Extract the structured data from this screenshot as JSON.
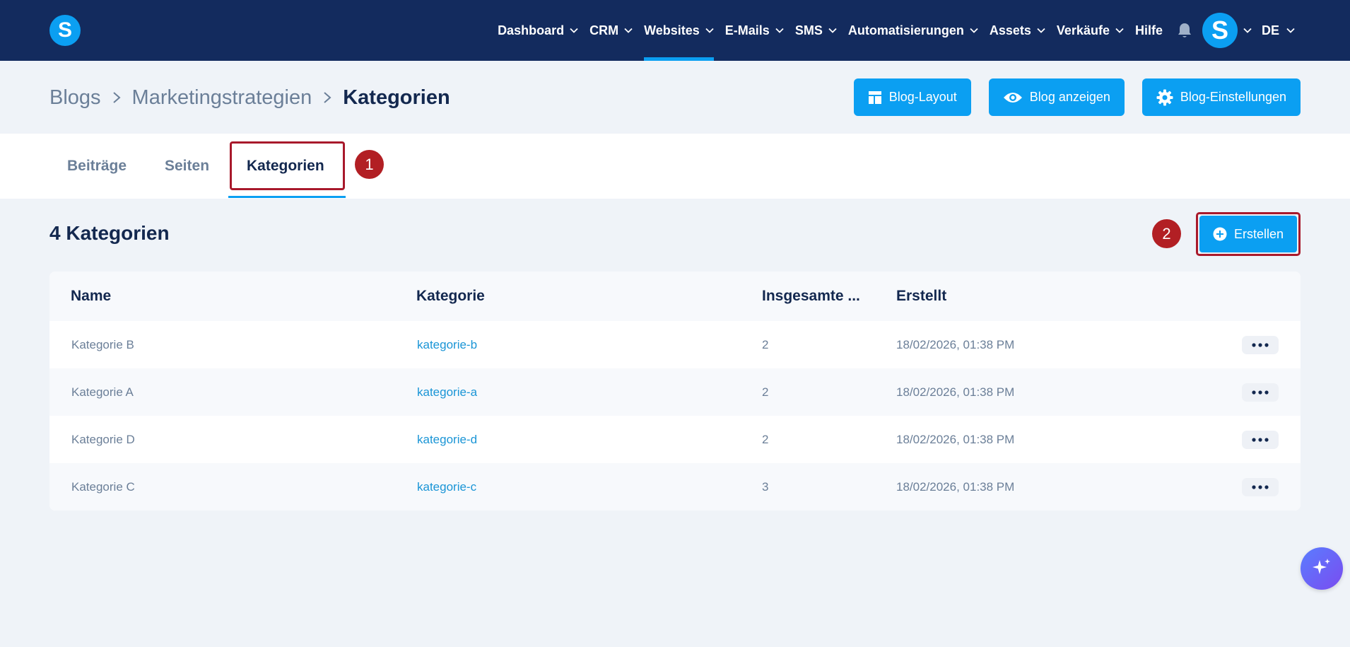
{
  "brand": {
    "logo_letter": "S",
    "accent": "#0b9ff2",
    "nav_bg": "#132b5e"
  },
  "topnav": {
    "items": [
      {
        "label": "Dashboard",
        "has_menu": true
      },
      {
        "label": "CRM",
        "has_menu": true
      },
      {
        "label": "Websites",
        "has_menu": true,
        "active": true
      },
      {
        "label": "E-Mails",
        "has_menu": true
      },
      {
        "label": "SMS",
        "has_menu": true
      },
      {
        "label": "Automatisierungen",
        "has_menu": true
      },
      {
        "label": "Assets",
        "has_menu": true
      },
      {
        "label": "Verkäufe",
        "has_menu": true
      },
      {
        "label": "Hilfe",
        "has_menu": false
      }
    ],
    "notifications_icon": "bell-icon",
    "avatar_letter": "S",
    "language": "DE"
  },
  "breadcrumb": {
    "items": [
      "Blogs",
      "Marketingstrategien",
      "Kategorien"
    ]
  },
  "header_buttons": {
    "layout": {
      "label": "Blog-Layout",
      "icon": "layout-icon"
    },
    "view": {
      "label": "Blog anzeigen",
      "icon": "eye-icon"
    },
    "settings": {
      "label": "Blog-Einstellungen",
      "icon": "gear-icon"
    }
  },
  "tabs": {
    "items": [
      {
        "label": "Beiträge"
      },
      {
        "label": "Seiten"
      },
      {
        "label": "Kategorien",
        "active": true
      }
    ]
  },
  "annotations": {
    "step1": "1",
    "step2": "2",
    "highlight_color": "#a8192b"
  },
  "section": {
    "title": "4 Kategorien",
    "create_label": "Erstellen"
  },
  "table": {
    "columns": {
      "name": "Name",
      "category": "Kategorie",
      "total": "Insgesamte ...",
      "created": "Erstellt"
    },
    "rows": [
      {
        "name": "Kategorie B",
        "slug": "kategorie-b",
        "total": "2",
        "created": "18/02/2026, 01:38 PM"
      },
      {
        "name": "Kategorie A",
        "slug": "kategorie-a",
        "total": "2",
        "created": "18/02/2026, 01:38 PM"
      },
      {
        "name": "Kategorie D",
        "slug": "kategorie-d",
        "total": "2",
        "created": "18/02/2026, 01:38 PM"
      },
      {
        "name": "Kategorie C",
        "slug": "kategorie-c",
        "total": "3",
        "created": "18/02/2026, 01:38 PM"
      }
    ]
  },
  "fab": {
    "icon": "sparkles-icon"
  }
}
